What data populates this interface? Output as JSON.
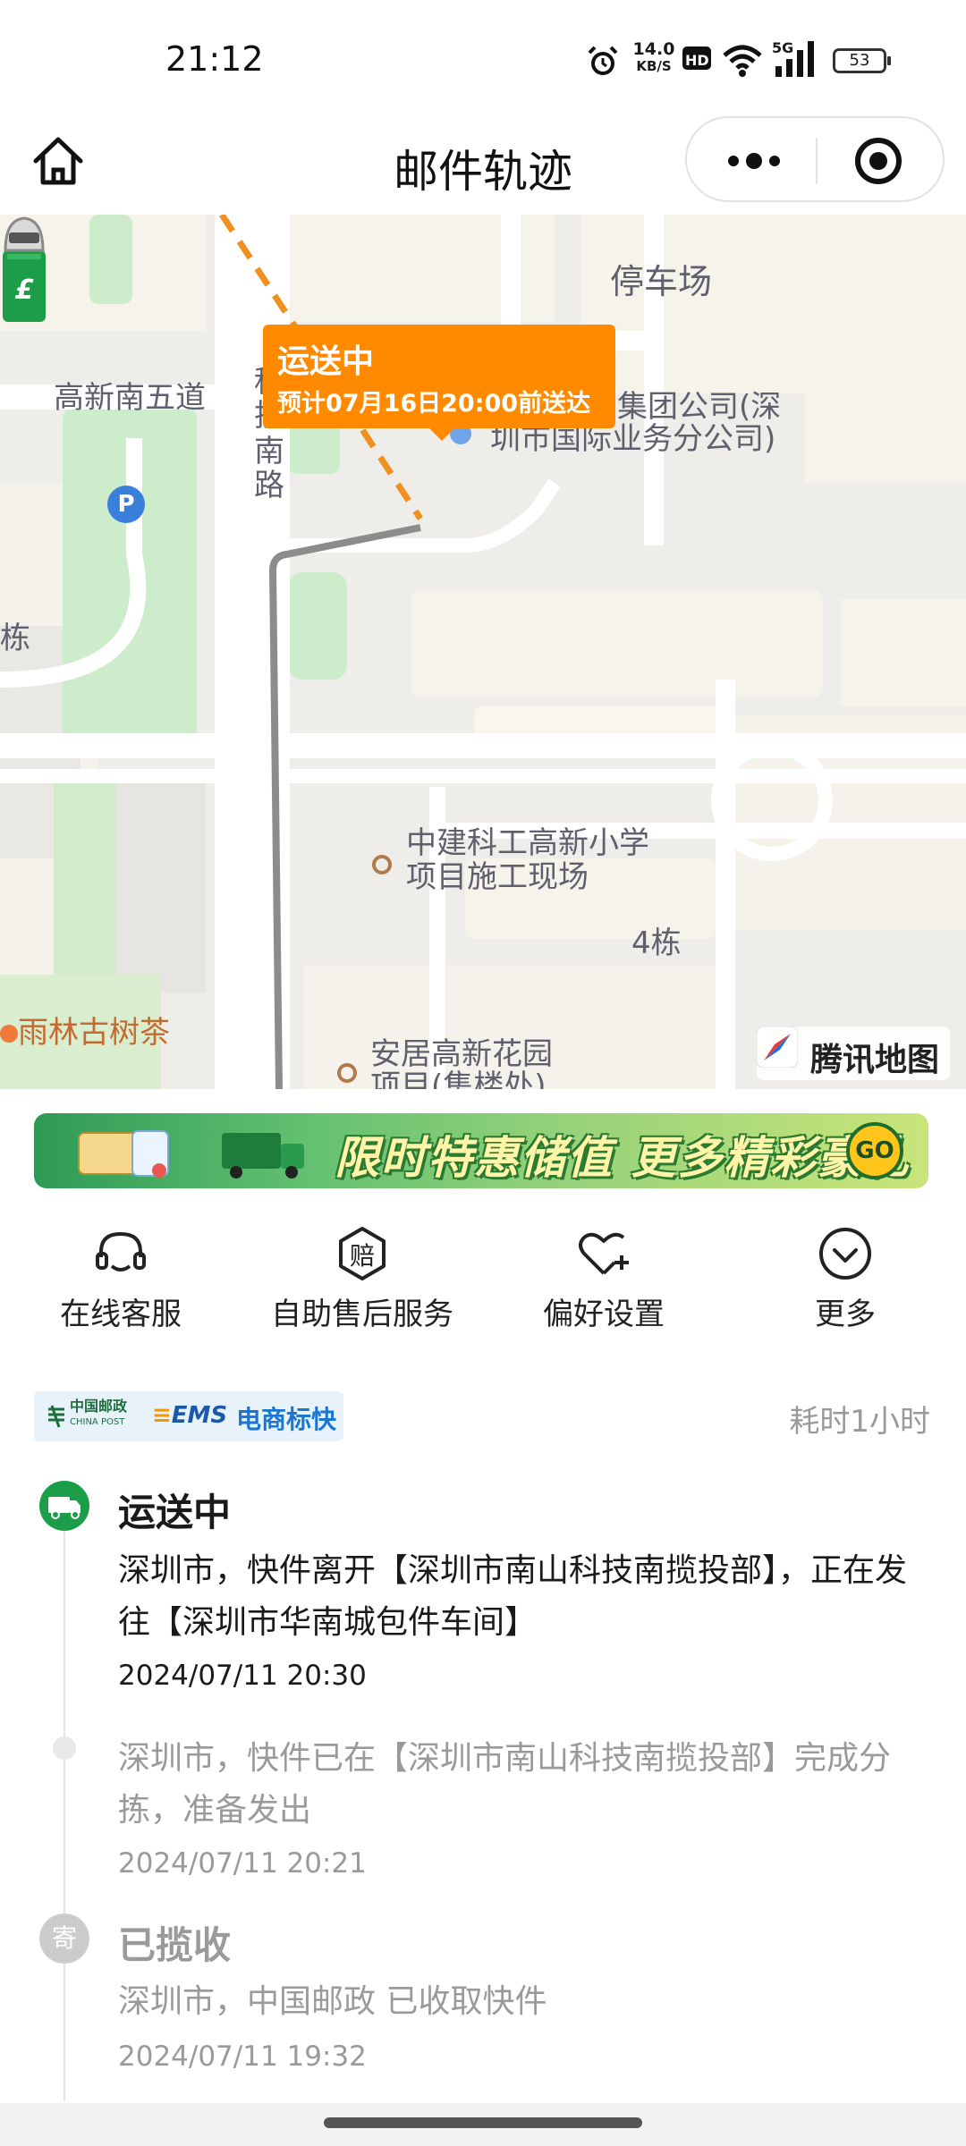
{
  "status_bar": {
    "time": "21:12",
    "net_speed_top": "14.0",
    "net_speed_bottom": "KB/S",
    "hd": "HD",
    "network": "5G",
    "battery": "53",
    "icons": [
      "alarm-icon",
      "hd-icon",
      "wifi-icon",
      "signal-5g-icon",
      "battery-icon"
    ]
  },
  "nav": {
    "title": "邮件轨迹",
    "home_icon": "home-icon",
    "more_icon": "more-dots-icon",
    "close_icon": "target-close-icon"
  },
  "map": {
    "bubble_title": "运送中",
    "bubble_sub": "预计07月16日20:00前送达",
    "labels": {
      "parking": "停车场",
      "road_1": "高新南五道",
      "road_2_a": "科",
      "road_2_b": "技",
      "road_2_c": "南",
      "road_2_d": "路",
      "company_a": "集团公司(深",
      "company_b": "圳市国际业务分公司)",
      "building_left": "栋",
      "school_a": "中建科工高新小学",
      "school_b": "项目施工现场",
      "building_4": "4栋",
      "tea": "雨林古树茶",
      "residence_a": "安居高新花园",
      "residence_b": "项目(集楼处)"
    },
    "parking_pin": "P",
    "provider": "腾讯地图"
  },
  "banner": {
    "text": "限时特惠储值 更多精彩豪礼",
    "go": "GO"
  },
  "actions": [
    {
      "icon": "headset-icon",
      "label": "在线客服"
    },
    {
      "icon": "compensation-icon",
      "label": "自助售后服务",
      "icon_text": "赔"
    },
    {
      "icon": "heart-plus-icon",
      "label": "偏好设置"
    },
    {
      "icon": "chevron-down-circle-icon",
      "label": "更多"
    }
  ],
  "shipment": {
    "brand_post": "中国邮政",
    "brand_post_en": "CHINA POST",
    "brand_ems": "EMS",
    "service": "电商标快",
    "duration": "耗时1小时"
  },
  "timeline": [
    {
      "status": "运送中",
      "desc": "深圳市，快件离开【深圳市南山科技南揽投部】，正在发往【深圳市华南城包件车间】",
      "time": "2024/07/11 20:30"
    },
    {
      "status": "",
      "desc": "深圳市，快件已在【深圳市南山科技南揽投部】完成分拣，准备发出",
      "time": "2024/07/11 20:21"
    },
    {
      "status": "已揽收",
      "node_text": "寄",
      "desc": "深圳市，中国邮政 已收取快件",
      "time": "2024/07/11 19:32"
    }
  ]
}
